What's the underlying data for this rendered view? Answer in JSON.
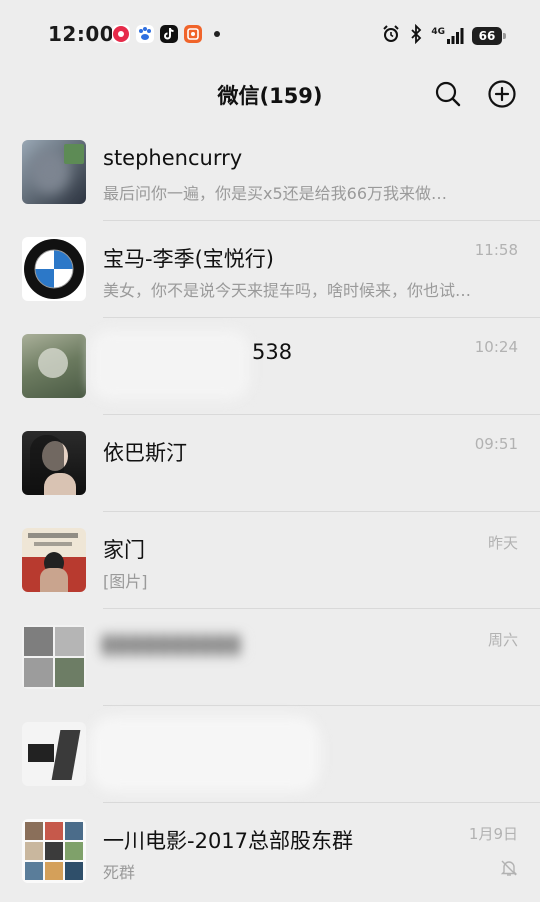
{
  "status_bar": {
    "time": "12:00",
    "network": "4G",
    "battery": "66"
  },
  "header": {
    "title": "微信(159)"
  },
  "chats": [
    {
      "name": "stephencurry",
      "preview": "最后问你一遍，你是买x5还是给我66万我来做…",
      "time": ""
    },
    {
      "name": "宝马-李季(宝悦行)",
      "preview": "美女，你不是说今天来提车吗，啥时候来，你也试…",
      "time": "11:58"
    },
    {
      "name": "538",
      "preview": "",
      "time": "10:24"
    },
    {
      "name": "依巴斯汀",
      "preview": "",
      "time": "09:51"
    },
    {
      "name": "家门",
      "preview": "[图片]",
      "time": "昨天"
    },
    {
      "name": "",
      "preview": "",
      "time": "周六"
    },
    {
      "name": "",
      "preview": "",
      "time": ""
    },
    {
      "name": "一川电影-2017总部股东群",
      "preview": "死群",
      "time": "1月9日",
      "muted": true
    }
  ],
  "colors": {
    "background": "#ededed",
    "divider": "#d9d9d9",
    "secondary_text": "#9a9a9a",
    "time_text": "#b2b2b2"
  }
}
